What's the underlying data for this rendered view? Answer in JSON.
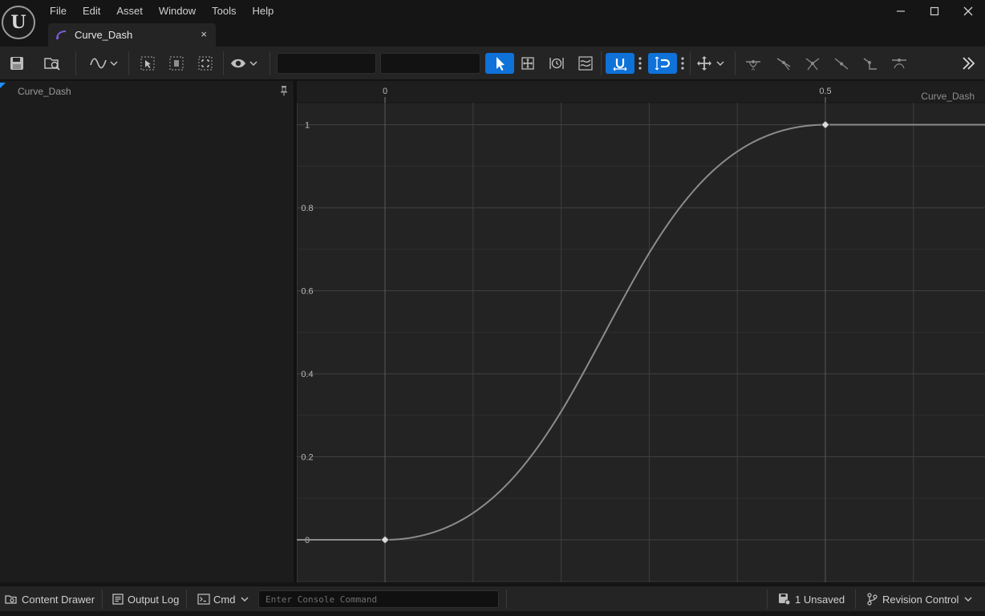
{
  "window": {
    "logo_text": "U",
    "menu": [
      "File",
      "Edit",
      "Asset",
      "Window",
      "Tools",
      "Help"
    ],
    "controls": {
      "minimize": "—",
      "maximize": "☐",
      "close": "✕"
    }
  },
  "tab": {
    "label": "Curve_Dash",
    "close": "×",
    "icon": "curve-asset-icon"
  },
  "toolbar": {
    "search_left_value": "",
    "search_right_value": "",
    "icons": [
      "save-icon",
      "browse-asset-icon",
      "curve-display-icon",
      "select-icon",
      "normalize-icon",
      "frame-icon",
      "view-options-icon",
      "select-tool-icon",
      "transform-tool-icon",
      "retime-tool-icon",
      "multi-select-tool-icon",
      "snap-time-icon",
      "snap-value-icon",
      "axis-lock-icon",
      "flatten-tangents-icon",
      "straighten-tangents-icon",
      "auto-tangent-icon",
      "linear-tangent-icon",
      "constant-tangent-icon",
      "weighted-tangent-icon",
      "expand-toolbar-icon"
    ]
  },
  "left_panel": {
    "item": "Curve_Dash",
    "pin": "pin-icon"
  },
  "graph": {
    "curve_name": "Curve_Dash",
    "accent": "#0e72d8"
  },
  "chart_data": {
    "type": "line",
    "title": "",
    "xlabel": "",
    "ylabel": "",
    "x_ticks": [
      0,
      0.5
    ],
    "x_tick_labels": [
      "0",
      "0.5"
    ],
    "y_ticks": [
      0,
      0.2,
      0.4,
      0.6,
      0.8,
      1
    ],
    "y_tick_labels": [
      "0",
      "0.2",
      "0.4",
      "0.6",
      "0.8",
      "1"
    ],
    "xlim": [
      -0.1,
      0.68
    ],
    "ylim": [
      -0.1,
      1.1
    ],
    "grid": true,
    "series": [
      {
        "name": "Curve_Dash",
        "color": "#8c8c8c",
        "interpolation": "cubic-ease-in-out",
        "keys": [
          {
            "x": 0,
            "y": 0
          },
          {
            "x": 0.5,
            "y": 1
          }
        ]
      }
    ]
  },
  "statusbar": {
    "content_drawer": "Content Drawer",
    "output_log": "Output Log",
    "cmd": "Cmd",
    "console_placeholder": "Enter Console Command",
    "unsaved": "1 Unsaved",
    "revision_control": "Revision Control"
  }
}
